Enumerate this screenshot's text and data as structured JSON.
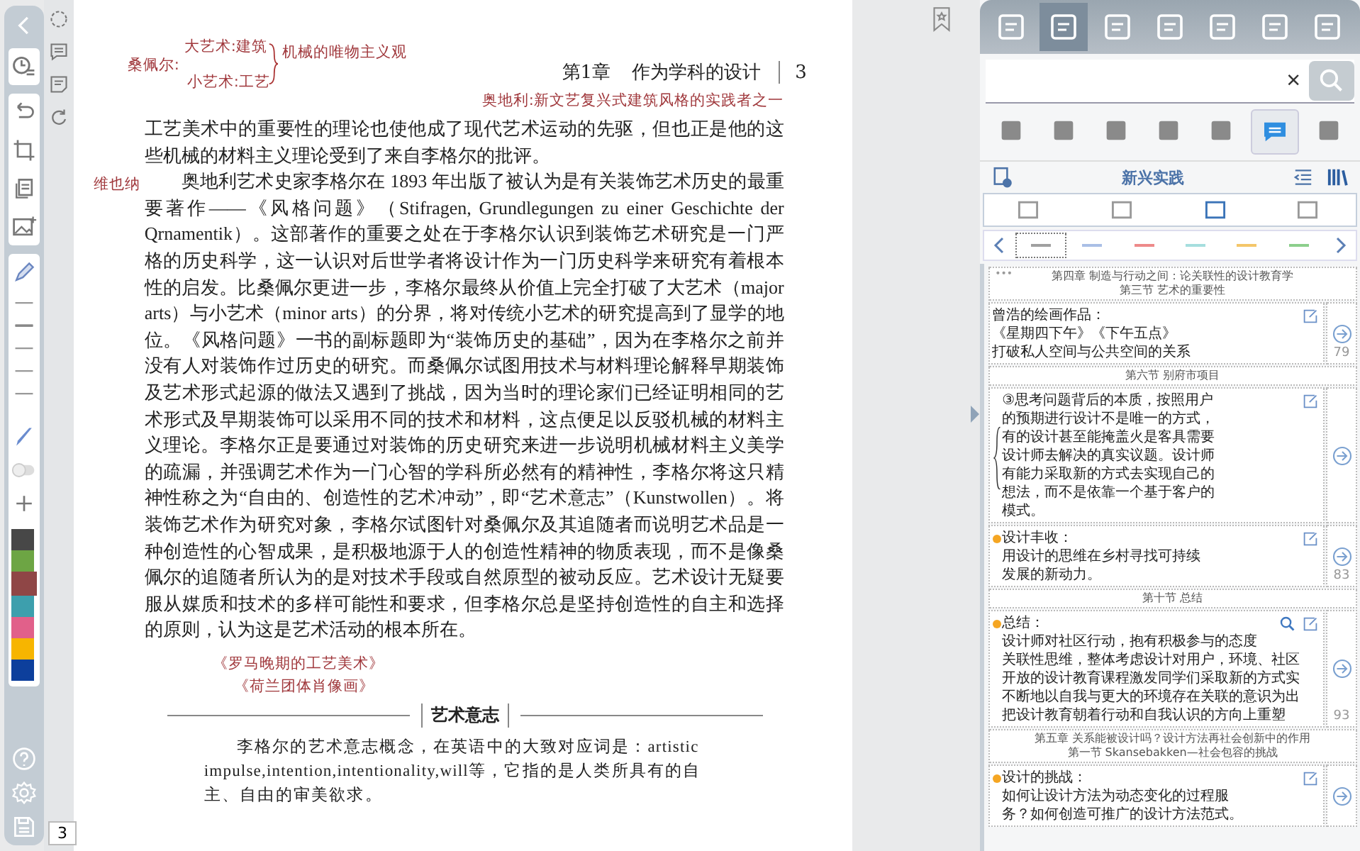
{
  "left_toolbar": {
    "swatches": [
      {
        "color": "#474747",
        "selected": false
      },
      {
        "color": "#6da544",
        "selected": false
      },
      {
        "color": "#8f4646",
        "selected": true
      },
      {
        "color": "#3d9fad",
        "selected": false
      },
      {
        "color": "#e1608a",
        "selected": false
      },
      {
        "color": "#f7b500",
        "selected": false
      },
      {
        "color": "#0d3f9c",
        "selected": false
      }
    ]
  },
  "page_number_box": "3",
  "page": {
    "header": {
      "chapter": "第1章",
      "title": "作为学科的设计",
      "page": "3"
    },
    "annotations": [
      "桑佩尔:",
      "大艺术:建筑",
      "小艺术:工艺",
      "机械的唯物主义观",
      "奥地利:新文艺复兴式建筑风格的实践者之一",
      "维也纳",
      "《罗马晚期的工艺美术》",
      "《荷兰团体肖像画》"
    ],
    "paragraphs": [
      {
        "indent": false,
        "text": "工艺美术中的重要性的理论也使他成了现代艺术运动的先驱，但也正是他的这些机械的材料主义理论受到了来自李格尔的批评。"
      },
      {
        "indent": true,
        "text": "奥地利艺术史家李格尔在 1893 年出版了被认为是有关装饰艺术历史的最重要著作——《风格问题》（Stifragen, Grundlegungen zu einer Geschichte der Qrnamentik）。这部著作的重要之处在于李格尔认识到装饰艺术研究是一门严格的历史科学，这一认识对后世学者将设计作为一门历史科学来研究有着根本性的启发。比桑佩尔更进一步，李格尔最终从价值上完全打破了大艺术（major arts）与小艺术（minor arts）的分界，将对传统小艺术的研究提高到了显学的地位。《风格问题》一书的副标题即为“装饰历史的基础”，因为在李格尔之前并没有人对装饰作过历史的研究。而桑佩尔试图用技术与材料理论解释早期装饰及艺术形式起源的做法又遇到了挑战，因为当时的理论家们已经证明相同的艺术形式及早期装饰可以采用不同的技术和材料，这点便足以反驳机械的材料主义理论。李格尔正是要通过对装饰的历史研究来进一步说明机械材料主义美学的疏漏，并强调艺术作为一门心智的学科所必然有的精神性，李格尔将这只精神性称之为“自由的、创造性的艺术冲动”，即“艺术意志”（Kunstwollen）。将装饰艺术作为研究对象，李格尔试图针对桑佩尔及其追随者而说明艺术品是一种创造性的心智成果，是积极地源于人的创造性精神的物质表现，而不是像桑佩尔的追随者所认为的是对技术手段或自然原型的被动反应。艺术设计无疑要服从媒质和技术的多样可能性和要求，但李格尔总是坚持创造性的自主和选择的原则，认为这是艺术活动的根本所在。"
      }
    ],
    "sidebar_box": {
      "title": "艺术意志",
      "text": "李格尔的艺术意志概念，在英语中的大致对应词是：artistic impulse,intention,intentionality,will等，它指的是人类所具有的自主、自由的审美欲求。"
    }
  },
  "right_panel": {
    "tools": [
      {
        "selected": false
      },
      {
        "selected": true
      },
      {
        "selected": false
      },
      {
        "selected": false
      },
      {
        "selected": false
      },
      {
        "selected": false
      },
      {
        "selected": false
      }
    ],
    "search": {
      "clear": "×"
    },
    "view_tabs": [
      {
        "selected": false
      },
      {
        "selected": false
      },
      {
        "selected": false
      },
      {
        "selected": false
      },
      {
        "selected": false
      },
      {
        "selected": true
      },
      {
        "selected": false
      }
    ],
    "notebook_title": "新兴实践",
    "insert_tools": [
      {
        "selected": false
      },
      {
        "selected": false
      },
      {
        "selected": true
      },
      {
        "selected": false
      }
    ],
    "line_filters": [
      {
        "color": "#a0a0a0",
        "selected": true
      },
      {
        "color": "#aabfe6",
        "selected": false
      },
      {
        "color": "#ee8a8a",
        "selected": false
      },
      {
        "color": "#a6dede",
        "selected": false
      },
      {
        "color": "#f4c66a",
        "selected": false
      },
      {
        "color": "#8ccf8c",
        "selected": false
      }
    ],
    "notes": [
      {
        "kind": "heading",
        "more": "•••",
        "lines": [
          "第四章  制造与行动之间：论关联性的设计教育学",
          "第三节 艺术的重要性"
        ]
      },
      {
        "kind": "note",
        "lines": [
          "曾浩的绘画作品：",
          "《星期四下午》《下午五点》",
          "打破私人空间与公共空间的关系"
        ],
        "page": "79"
      },
      {
        "kind": "heading",
        "lines": [
          "第六节 别府市项目"
        ]
      },
      {
        "kind": "note",
        "bracket": true,
        "lines": [
          "③思考问题背后的本质，按照用户",
          "的预期进行设计不是唯一的方式，",
          "有的设计甚至能掩盖火是客具需要",
          "设计师去解决的真实议题。设计师",
          "有能力采取新的方式去实现自己的",
          "想法，而不是依靠一个基于客户的",
          "模式。"
        ]
      },
      {
        "kind": "note",
        "color": "#f5a623",
        "lines": [
          "设计丰收：",
          "用设计的思维在乡村寻找可持续",
          "发展的新动力。"
        ],
        "page": "83"
      },
      {
        "kind": "heading",
        "lines": [
          "第十节 总结"
        ]
      },
      {
        "kind": "note",
        "color": "#f5a623",
        "magnifier": true,
        "lines": [
          "总结：",
          "设计师对社区行动，抱有积极参与的态度",
          "关联性思维，整体考虑设计对用户，环境、社区",
          "开放的设计教育课程激发同学们采取新的方式实",
          "不断地以自我与更大的环境存在关联的意识为出",
          "把设计教育朝着行动和自我认识的方向上重塑"
        ],
        "page": "93"
      },
      {
        "kind": "heading",
        "lines": [
          "第五章  关系能被设计吗？设计方法再社会创新中的作用",
          "第一节 Skansebakken—社会包容的挑战"
        ]
      },
      {
        "kind": "note",
        "color": "#f5a623",
        "lines": [
          "设计的挑战：",
          "如何让设计方法为动态变化的过程服",
          "务？如何创造可推广的设计方法范式。"
        ]
      }
    ]
  }
}
